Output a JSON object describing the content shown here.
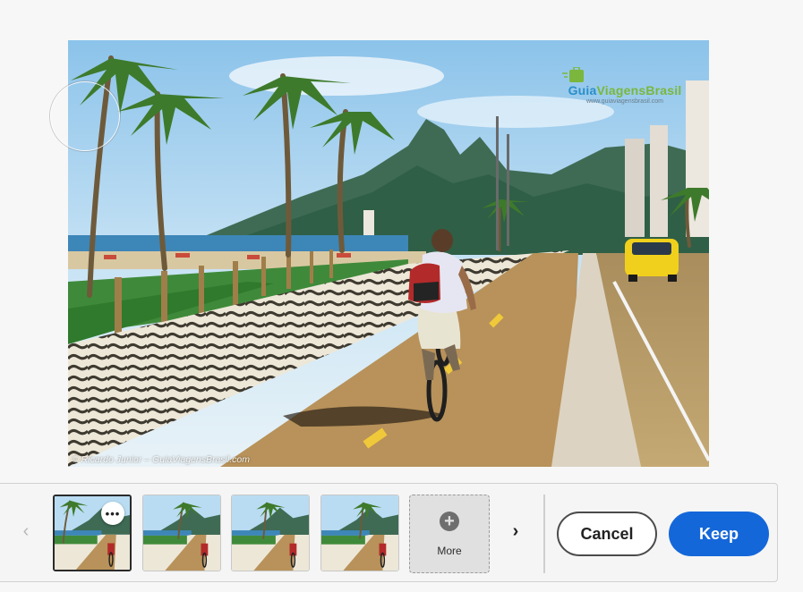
{
  "photo": {
    "watermark_brand_part1": "Guia",
    "watermark_brand_part2": "ViagensBrasil",
    "watermark_url": "www.guiaviagensbrasil.com",
    "credit": "© Ricardo Junior – GuiaViagensBrasil.com"
  },
  "variations": {
    "thumbnails": [
      {
        "name": "variation-1",
        "selected": true
      },
      {
        "name": "variation-2",
        "selected": false
      },
      {
        "name": "variation-3",
        "selected": false
      },
      {
        "name": "variation-4",
        "selected": false
      }
    ],
    "more_options_glyph": "•••",
    "more_label": "More",
    "prev_glyph": "‹",
    "next_glyph": "›"
  },
  "actions": {
    "cancel_label": "Cancel",
    "keep_label": "Keep"
  },
  "colors": {
    "accent": "#1467d9",
    "sky": "#a9d4f0",
    "mountain": "#3f6b55",
    "road": "#b59a63",
    "bike_lane": "#b8925a"
  }
}
